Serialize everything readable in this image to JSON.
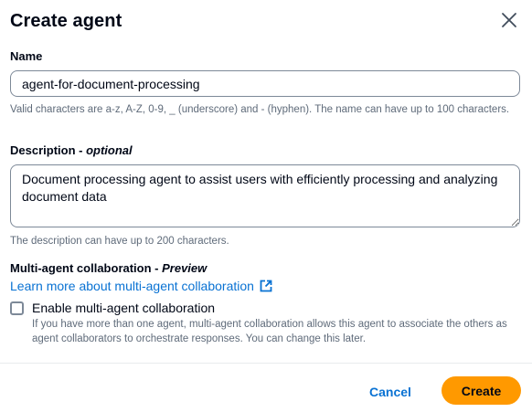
{
  "dialog": {
    "title": "Create agent",
    "close_icon": "close-icon"
  },
  "name_field": {
    "label": "Name",
    "value": "agent-for-document-processing",
    "hint": "Valid characters are a-z, A-Z, 0-9, _ (underscore) and - (hyphen). The name can have up to 100 characters."
  },
  "description_field": {
    "label": "Description - ",
    "label_optional": "optional",
    "value": "Document processing agent to assist users with efficiently processing and analyzing document data",
    "hint": "The description can have up to 200 characters."
  },
  "collaboration": {
    "label": "Multi-agent collaboration - ",
    "label_preview": "Preview",
    "learn_more_link": "Learn more about multi-agent collaboration",
    "external_icon": "external-link-icon",
    "checkbox_label": "Enable multi-agent collaboration",
    "checkbox_checked": false,
    "checkbox_description": "If you have more than one agent, multi-agent collaboration allows this agent to associate the others as agent collaborators to orchestrate responses. You can change this later."
  },
  "footer": {
    "cancel_label": "Cancel",
    "create_label": "Create"
  },
  "colors": {
    "primary_button": "#ff9900",
    "link": "#0972d3",
    "text": "#000716",
    "hint_text": "#5f6b7a"
  }
}
